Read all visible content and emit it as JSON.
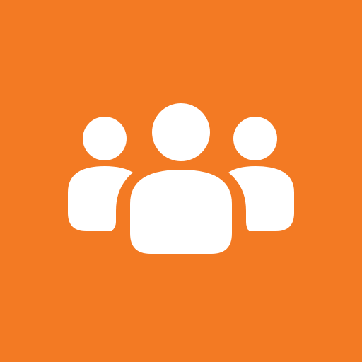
{
  "app_icon": {
    "icon": "group-users-icon",
    "background_color": "#F37A23",
    "glyph_color": "#FFFFFF"
  }
}
